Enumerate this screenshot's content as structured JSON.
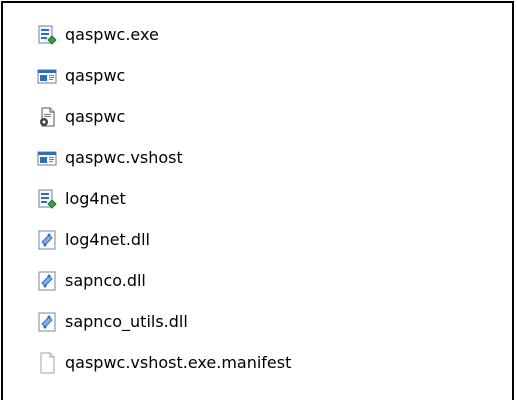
{
  "file_list": {
    "items": [
      {
        "name": "qaspwc.exe",
        "icon": "setup-exe-icon"
      },
      {
        "name": "qaspwc",
        "icon": "application-window-icon"
      },
      {
        "name": "qaspwc",
        "icon": "config-document-icon"
      },
      {
        "name": "qaspwc.vshost",
        "icon": "application-window-icon"
      },
      {
        "name": "log4net",
        "icon": "setup-exe-icon"
      },
      {
        "name": "log4net.dll",
        "icon": "dll-extension-icon"
      },
      {
        "name": "sapnco.dll",
        "icon": "dll-extension-icon"
      },
      {
        "name": "sapnco_utils.dll",
        "icon": "dll-extension-icon"
      },
      {
        "name": "qaspwc.vshost.exe.manifest",
        "icon": "generic-file-icon"
      }
    ]
  },
  "colors": {
    "frame_border": "#000000",
    "background": "#ffffff",
    "text": "#000000",
    "icon_blue": "#2f6fb7",
    "icon_green": "#3f9b3f"
  }
}
